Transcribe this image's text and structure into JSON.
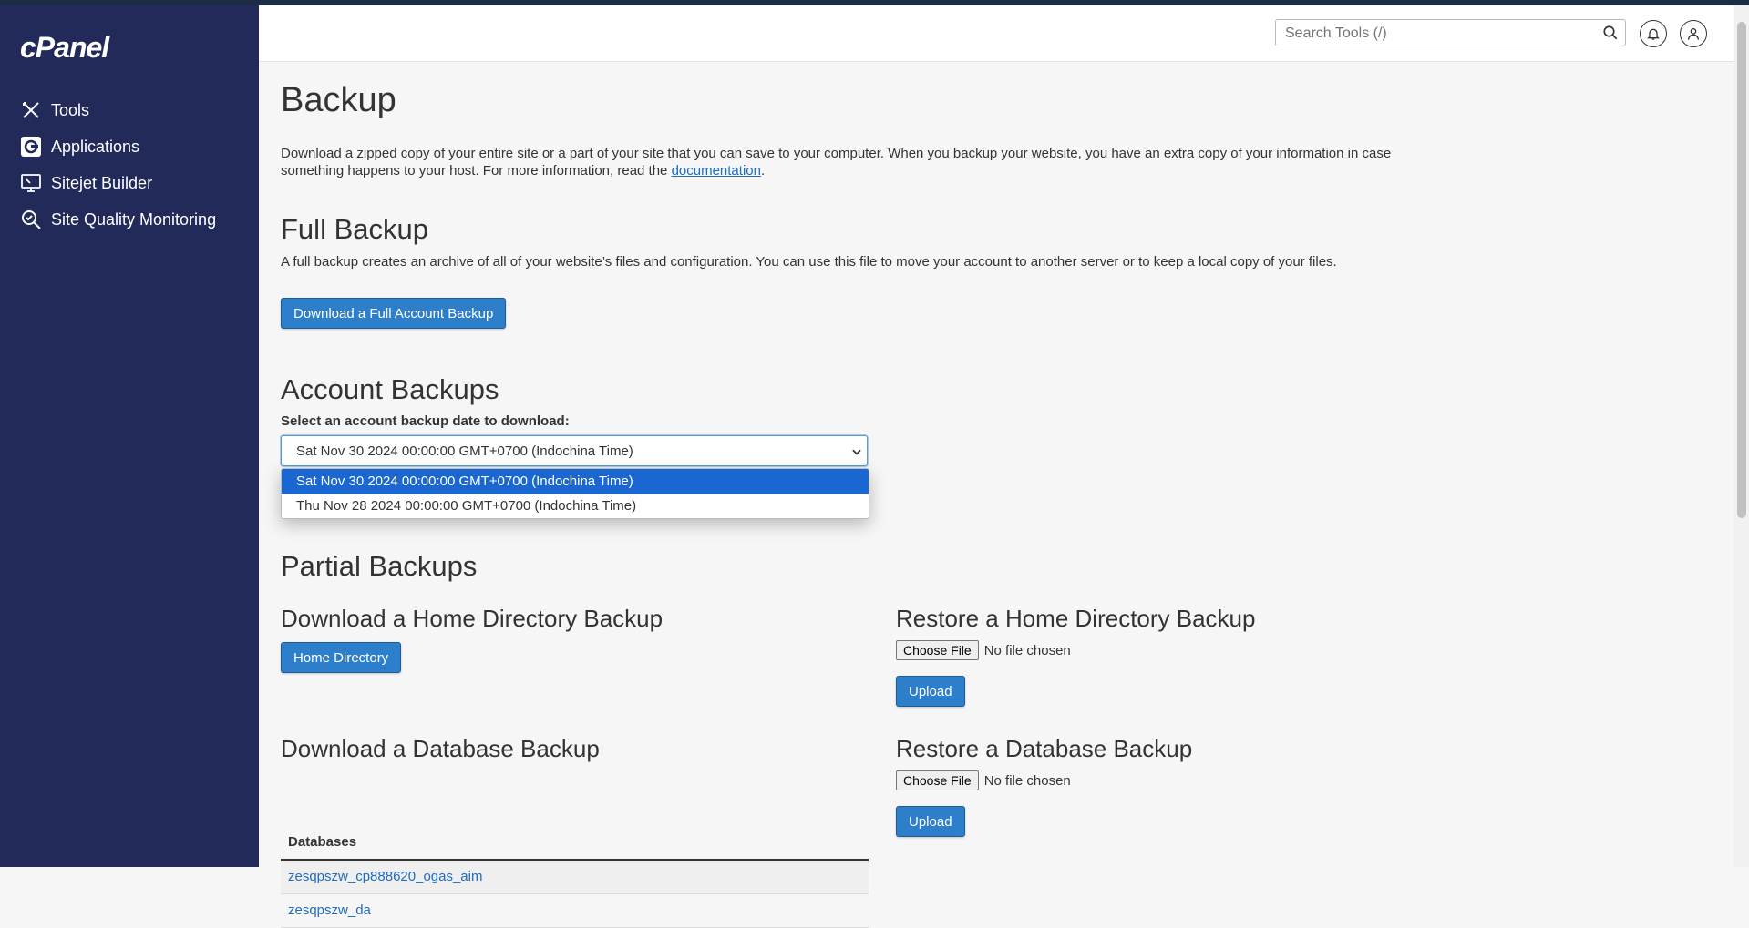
{
  "sidebar": {
    "logo": "cPanel",
    "items": [
      {
        "label": "Tools",
        "icon": "tools-icon"
      },
      {
        "label": "Applications",
        "icon": "applications-icon"
      },
      {
        "label": "Sitejet Builder",
        "icon": "sitejet-icon"
      },
      {
        "label": "Site Quality Monitoring",
        "icon": "site-quality-icon"
      }
    ]
  },
  "header": {
    "search_placeholder": "Search Tools (/)"
  },
  "page": {
    "title": "Backup",
    "intro_before": "Download a zipped copy of your entire site or a part of your site that you can save to your computer. When you backup your website, you have an extra copy of your information in case something happens to your host. For more information, read the ",
    "intro_link": "documentation",
    "intro_after": "."
  },
  "full_backup": {
    "heading": "Full Backup",
    "description": "A full backup creates an archive of all of your website’s files and configuration. You can use this file to move your account to another server or to keep a local copy of your files.",
    "button": "Download a Full Account Backup"
  },
  "account_backups": {
    "heading": "Account Backups",
    "select_label": "Select an account backup date to download:",
    "selected": "Sat Nov 30 2024 00:00:00 GMT+0700 (Indochina Time)",
    "options": [
      "Sat Nov 30 2024 00:00:00 GMT+0700 (Indochina Time)",
      "Thu Nov 28 2024 00:00:00 GMT+0700 (Indochina Time)"
    ]
  },
  "partial": {
    "heading": "Partial Backups",
    "home_download_heading": "Download a Home Directory Backup",
    "home_button": "Home Directory",
    "home_restore_heading": "Restore a Home Directory Backup",
    "choose_file": "Choose File",
    "no_file": "No file chosen",
    "upload": "Upload",
    "db_download_heading": "Download a Database Backup",
    "db_restore_heading": "Restore a Database Backup",
    "db_column": "Databases",
    "databases": [
      "zesqpszw_cp888620_ogas_aim",
      "zesqpszw_da"
    ]
  },
  "colors": {
    "sidebar_bg": "#222a59",
    "primary_button": "#2d7fcc",
    "link": "#1f6cbf",
    "option_selected": "#1a67d2"
  }
}
